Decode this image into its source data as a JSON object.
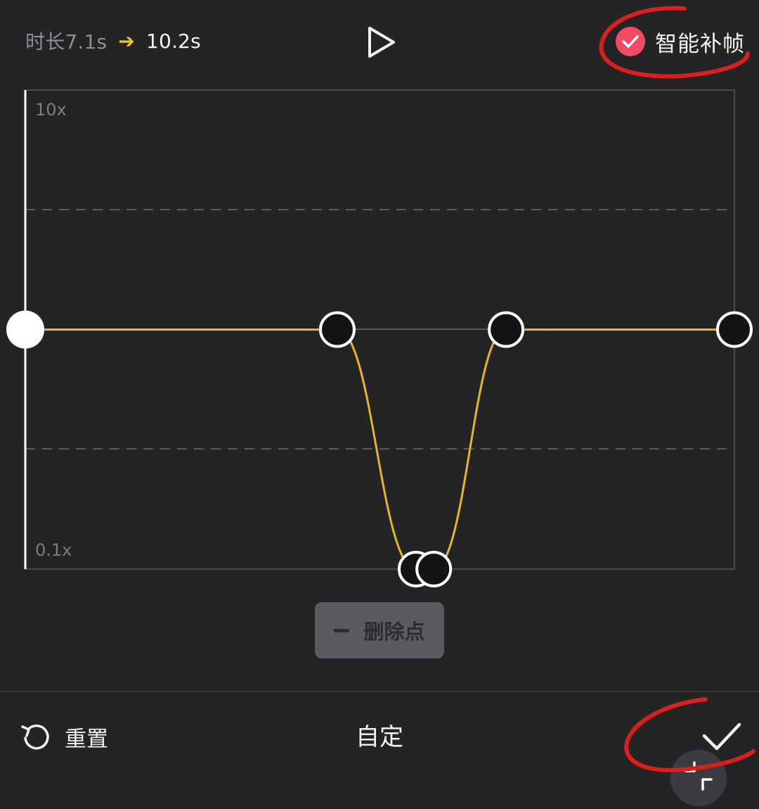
{
  "header": {
    "duration_old": "时长7.1s",
    "duration_arrow": "➔",
    "duration_new": "10.2s",
    "play_icon": "play-icon",
    "smart_frame_label": "智能补帧",
    "smart_frame_checked": true
  },
  "graph": {
    "y_max_label": "10x",
    "y_min_label": "0.1x",
    "curve_color": "#e4b728"
  },
  "chart_data": {
    "type": "line",
    "y_scale": "log",
    "ylim": [
      0.1,
      10
    ],
    "xlim": [
      0,
      1
    ],
    "grid": true,
    "points": [
      {
        "x": 0.0,
        "y": 1.0,
        "selected": true
      },
      {
        "x": 0.44,
        "y": 1.0
      },
      {
        "x": 0.551,
        "y": 0.1
      },
      {
        "x": 0.576,
        "y": 0.1
      },
      {
        "x": 0.678,
        "y": 1.0
      },
      {
        "x": 1.0,
        "y": 1.0
      }
    ]
  },
  "actions": {
    "delete_point_label": "删除点",
    "reset_label": "重置",
    "mode_title": "自定",
    "confirm_icon": "checkmark-icon",
    "floating_icon": "minimize-icon"
  },
  "colors": {
    "background": "#242326",
    "accent_yellow": "#f2c230",
    "accent_pink": "#f24a63",
    "annotation_red": "#d9201f"
  }
}
